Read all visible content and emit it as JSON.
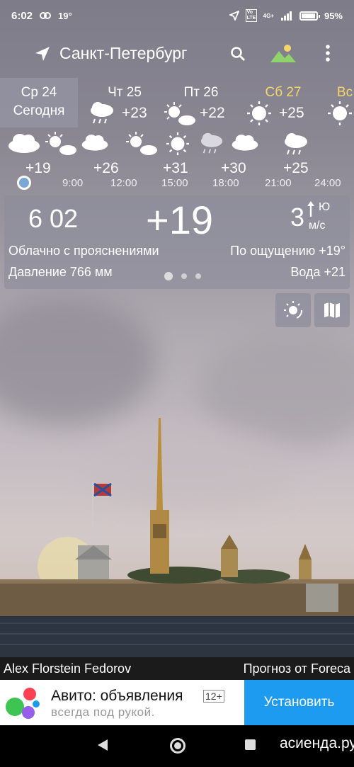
{
  "status_bar": {
    "time": "6:02",
    "temp_notice": "19°",
    "network": "4G+",
    "volte": "Vo LTE",
    "battery": "95%"
  },
  "toolbar": {
    "city": "Санкт-Петербург",
    "icons": [
      "location-arrow-icon",
      "search-icon",
      "landscape-icon",
      "more-vert-icon"
    ]
  },
  "days": [
    {
      "name": "Ср 24",
      "sub": "Сегодня",
      "selected": true
    },
    {
      "name": "Чт 25",
      "temp": "+23",
      "icon": "rain-cloud-icon"
    },
    {
      "name": "Пт 26",
      "temp": "+22",
      "icon": "sun-cloud-icon"
    },
    {
      "name": "Сб 27",
      "temp": "+25",
      "icon": "sun-icon",
      "weekend": true
    },
    {
      "name": "Вс",
      "icon": "sun-icon",
      "weekend": true
    }
  ],
  "hours": [
    {
      "temp": "+19",
      "time": "",
      "icon": "cloud-icon"
    },
    {
      "temp": "+26",
      "time": "9:00",
      "icon": "sun-cloud-icon"
    },
    {
      "temp": "+31",
      "time": "12:00",
      "icon": "cloud-icon"
    },
    {
      "temp": "+30",
      "time": "15:00",
      "icon": "sun-cloud-icon"
    },
    {
      "temp": "+25",
      "time": "18:00",
      "icon": "sun-icon"
    },
    {
      "temp": "",
      "time": "21:00",
      "icon": "rain-cloud-icon"
    },
    {
      "temp": "",
      "time": "24:00",
      "icon": "cloud-icon"
    },
    {
      "temp": "",
      "time": "",
      "icon": "rain-cloud-icon"
    }
  ],
  "current": {
    "time": "6 02",
    "temp": "+19",
    "wind_speed": "3",
    "wind_dir": "Ю",
    "wind_unit": "м/с",
    "condition": "Облачно с прояснениями",
    "feels_like": "По ощущению +19°",
    "pressure": "Давление 766 мм",
    "water": "Вода +21"
  },
  "credits": {
    "photo": "Alex Florstein Fedorov",
    "provider": "Прогноз от Foreca"
  },
  "ad": {
    "title": "Авито: объявления",
    "age": "12+",
    "subtitle": "всегда под рукой.",
    "button": "Установить"
  },
  "watermark": "асиенда.ру",
  "colors": {
    "weekend": "#f5d66b",
    "ad_button": "#1d9bf0",
    "selected_day": "#9696a5"
  }
}
